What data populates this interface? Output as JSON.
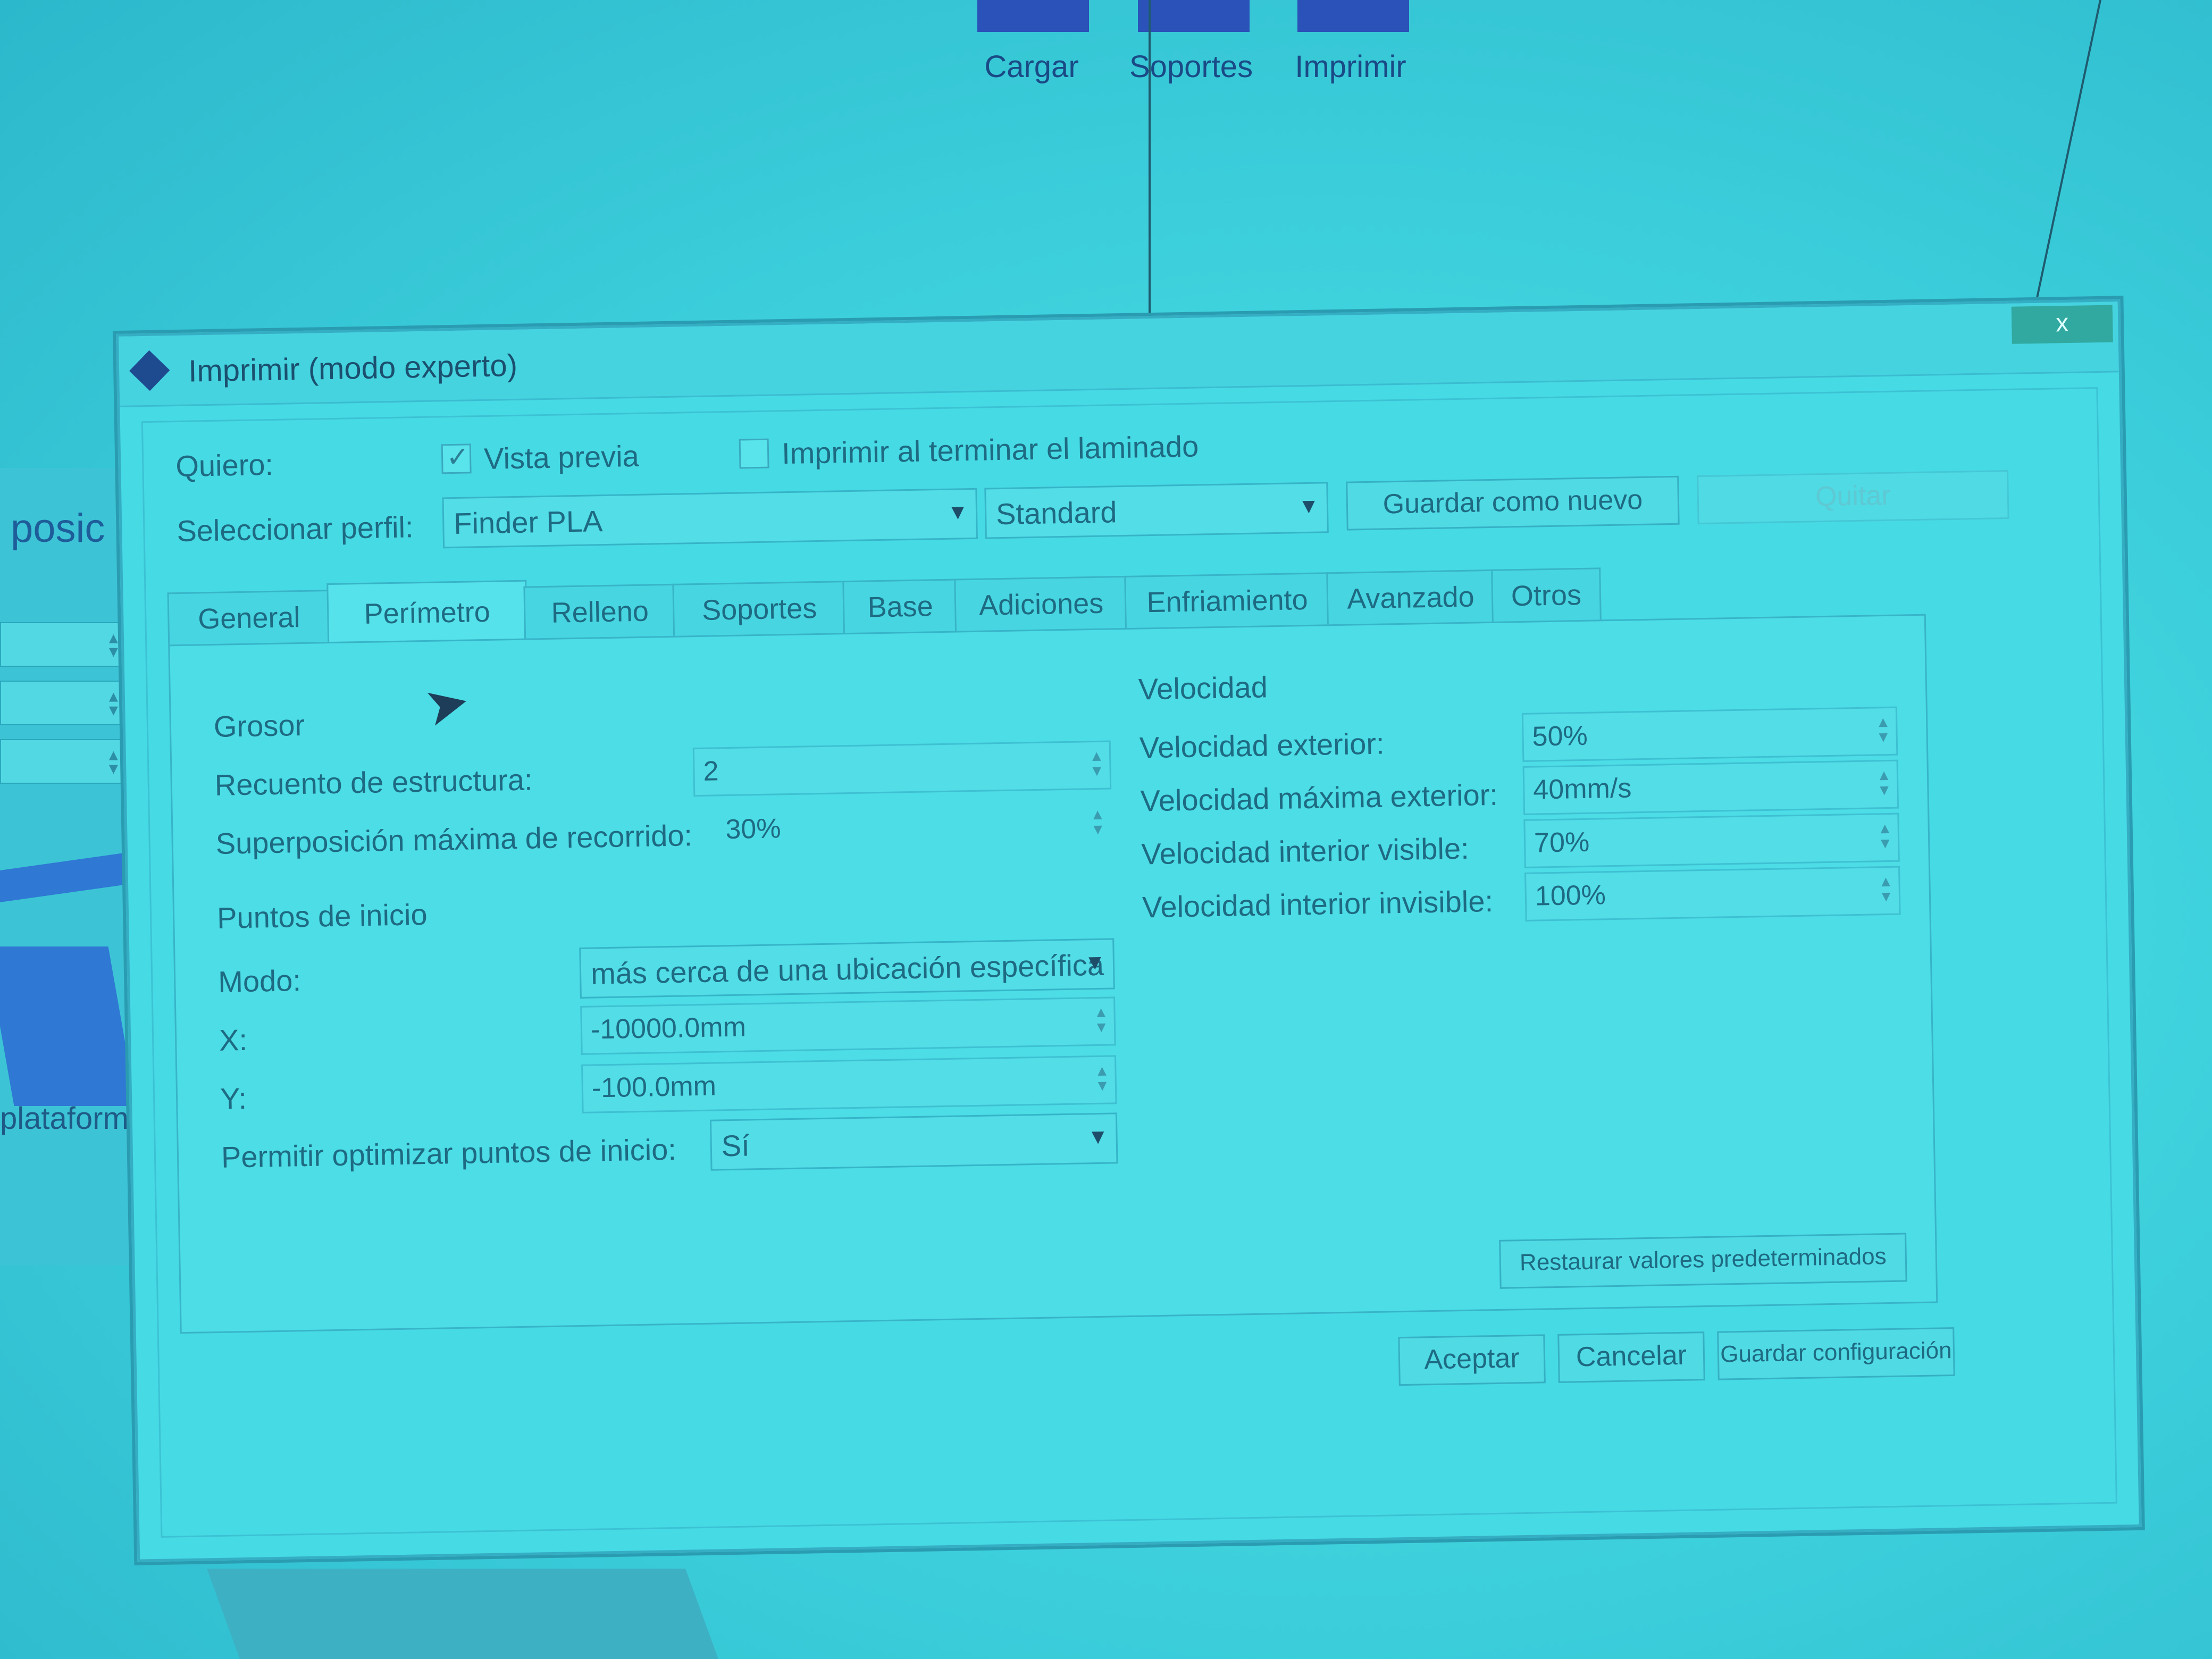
{
  "app_toolbar": {
    "load_label": "Cargar",
    "supports_label": "Soportes",
    "print_label": "Imprimir"
  },
  "left_panel": {
    "title": "posic",
    "bottom_label": "plataforma"
  },
  "dialog": {
    "title": "Imprimir (modo experto)",
    "close_label": "x",
    "want_label": "Quiero:",
    "preview_label": "Vista previa",
    "preview_checked": true,
    "print_after_label": "Imprimir al terminar el laminado",
    "print_after_checked": false,
    "profile_label": "Seleccionar perfil:",
    "profile_value": "Finder PLA",
    "quality_value": "Standard",
    "save_new_label": "Guardar como nuevo",
    "remove_label": "Quitar",
    "tabs": [
      "General",
      "Perímetro",
      "Relleno",
      "Soportes",
      "Base",
      "Adiciones",
      "Enfriamiento",
      "Avanzado",
      "Otros"
    ],
    "active_tab": "Perímetro",
    "thickness": {
      "heading": "Grosor",
      "shell_count_label": "Recuento de estructura:",
      "shell_count_value": "2",
      "overlap_label": "Superposición máxima de recorrido:",
      "overlap_value": "30%"
    },
    "start_points": {
      "heading": "Puntos de inicio",
      "mode_label": "Modo:",
      "mode_value": "más cerca de una ubicación específica",
      "x_label": "X:",
      "x_value": "-10000.0mm",
      "y_label": "Y:",
      "y_value": "-100.0mm",
      "optimize_label": "Permitir optimizar puntos de inicio:",
      "optimize_value": "Sí"
    },
    "speed": {
      "heading": "Velocidad",
      "outer_label": "Velocidad exterior:",
      "outer_value": "50%",
      "outer_max_label": "Velocidad máxima exterior:",
      "outer_max_value": "40mm/s",
      "inner_visible_label": "Velocidad interior visible:",
      "inner_visible_value": "70%",
      "inner_invisible_label": "Velocidad interior invisible:",
      "inner_invisible_value": "100%"
    },
    "restore_label": "Restaurar valores predeterminados",
    "accept_label": "Aceptar",
    "cancel_label": "Cancelar",
    "save_config_label": "Guardar configuración"
  }
}
